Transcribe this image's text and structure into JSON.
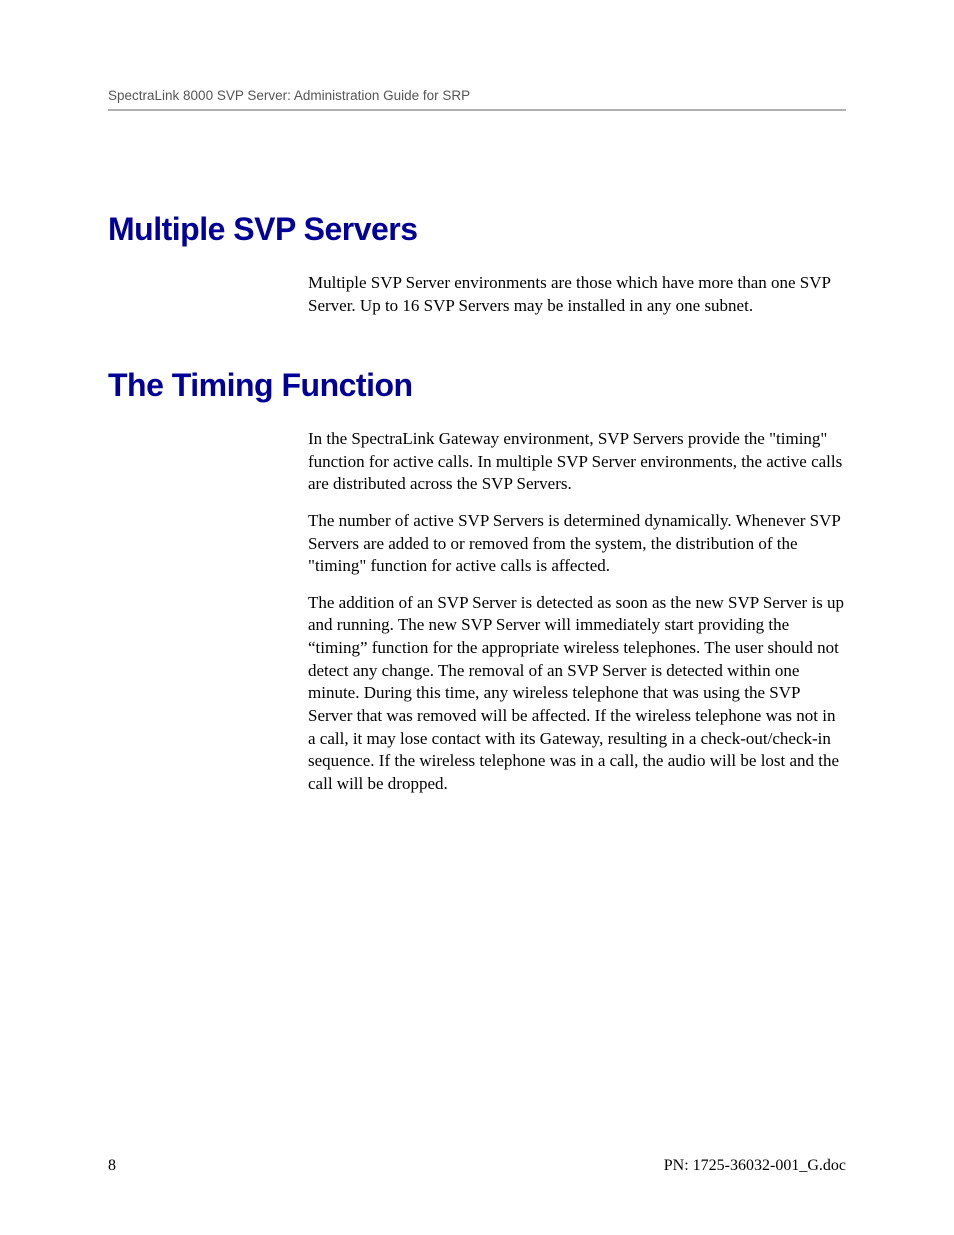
{
  "header": {
    "title": "SpectraLink 8000 SVP Server: Administration Guide for SRP"
  },
  "sections": [
    {
      "heading": "Multiple SVP Servers",
      "paragraphs": [
        "Multiple SVP Server environments are those which have more than one SVP Server. Up to 16 SVP Servers may be installed in any one subnet."
      ]
    },
    {
      "heading": "The Timing Function",
      "paragraphs": [
        "In the SpectraLink Gateway environment, SVP Servers provide the \"timing\" function for active calls. In multiple SVP Server environments, the active calls are distributed across the SVP Servers.",
        "The number of active SVP Servers is determined dynamically. Whenever SVP Servers are added to or removed from the system, the distribution of the \"timing\" function for active calls is affected.",
        "The addition of an SVP Server is detected as soon as the new SVP Server is up and running. The new SVP Server will immediately start providing the “timing” function for the appropriate wireless telephones. The user should not detect any change. The removal of an SVP Server is detected within one minute. During this time, any wireless telephone that was using the SVP Server that was removed will be affected. If the wireless telephone was not in a call, it may lose contact with its Gateway, resulting in a check-out/check-in sequence. If the wireless telephone was in a call, the audio will be lost and the call will be dropped."
      ]
    }
  ],
  "footer": {
    "page_number": "8",
    "doc_id": "PN: 1725-36032-001_G.doc"
  }
}
